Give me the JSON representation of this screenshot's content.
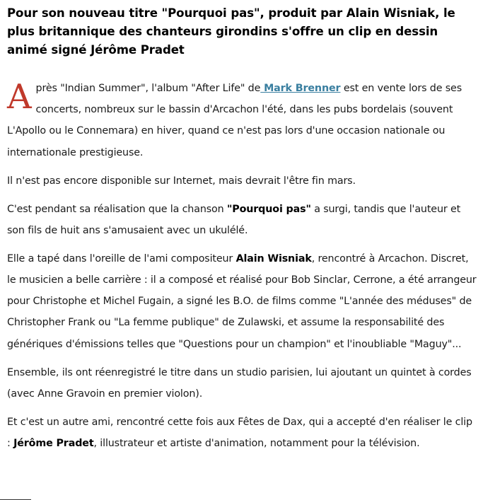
{
  "article": {
    "headline": "Pour son nouveau titre \"Pourquoi pas\", produit par Alain Wisniak, le plus britannique des chanteurs girondins s'offre un clip en dessin animé signé Jérôme Pradet",
    "p1": {
      "dropcap": "A",
      "text_before_link": "près \"Indian Summer\", l'album \"After Life\" de",
      "link": " Mark Brenner",
      "text_after_link": " est en vente lors de ses concerts, nombreux sur le bassin d'Arcachon l'été, dans les pubs bordelais (souvent L'Apollo ou le Connemara) en hiver, quand ce n'est pas lors d'une occasion nationale ou internationale prestigieuse."
    },
    "p2": {
      "text": "Il n'est pas encore disponible sur Internet, mais devrait l'être fin mars."
    },
    "p3": {
      "before": "C'est pendant sa réalisation que la chanson ",
      "bold": "\"Pourquoi pas\"",
      "after": " a surgi, tandis que l'auteur et son fils de huit ans s'amusaient avec un ukulélé."
    },
    "p4": {
      "before": "Elle a tapé dans l'oreille de l'ami compositeur ",
      "bold": "Alain Wisniak",
      "after": ", rencontré à Arcachon. Discret, le musicien a belle carrière : il a composé et réalisé pour Bob Sinclar,  Cerrone, a été arrangeur pour Christophe et Michel Fugain, a  signé les B.O. de films comme  \"L'année des méduses\" de Christopher Frank ou \"La femme publique\" de Zulawski, et assume la responsabilité des génériques d'émissions telles que \"Questions pour un champion\" et  l'inoubliable \"Maguy\"..."
    },
    "p5": {
      "text": "Ensemble, ils ont réenregistré le titre dans un studio parisien, lui ajoutant un quintet à cordes (avec Anne Gravoin en premier violon)."
    },
    "p6": {
      "before": "Et c'est un autre ami, rencontré cette fois aux Fêtes de Dax, qui a accepté d'en réaliser le clip : ",
      "bold": "Jérôme Pradet",
      "after": ", illustrateur et artiste d'animation, notamment pour la télévision."
    }
  },
  "colors": {
    "dropcap": "#c0392b",
    "link": "#3a7fa0",
    "text": "#1a1a1a"
  }
}
